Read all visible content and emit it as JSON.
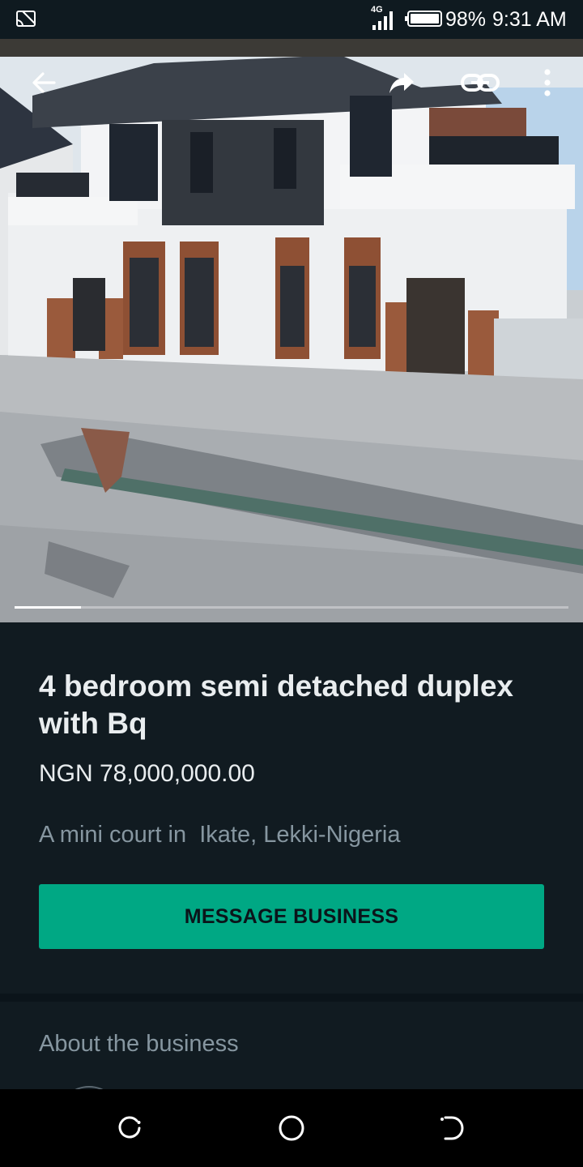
{
  "status_bar": {
    "network_label": "4G",
    "battery_percent": "98%",
    "time": "9:31 AM",
    "icons": [
      "cast-icon",
      "signal-icon",
      "battery-icon"
    ]
  },
  "hero": {
    "image_alt": "",
    "image_count_progress": 0.12,
    "actions": {
      "back": "back-arrow-icon",
      "share": "share-forward-icon",
      "link": "link-icon",
      "more": "more-vertical-icon"
    }
  },
  "product": {
    "title": "4 bedroom semi detached duplex with Bq",
    "price": "NGN 78,000,000.00",
    "description": "A mini court in  Ikate, Lekki-Nigeria",
    "cta_label": "MESSAGE BUSINESS"
  },
  "about": {
    "title": "About the business"
  },
  "nav_bar": {
    "icons": [
      "recent-apps-icon",
      "home-circle-icon",
      "back-nav-icon"
    ]
  },
  "colors": {
    "background": "#111b21",
    "accent": "#00a884",
    "primary_text": "#e9edef",
    "secondary_text": "#8696a0"
  }
}
